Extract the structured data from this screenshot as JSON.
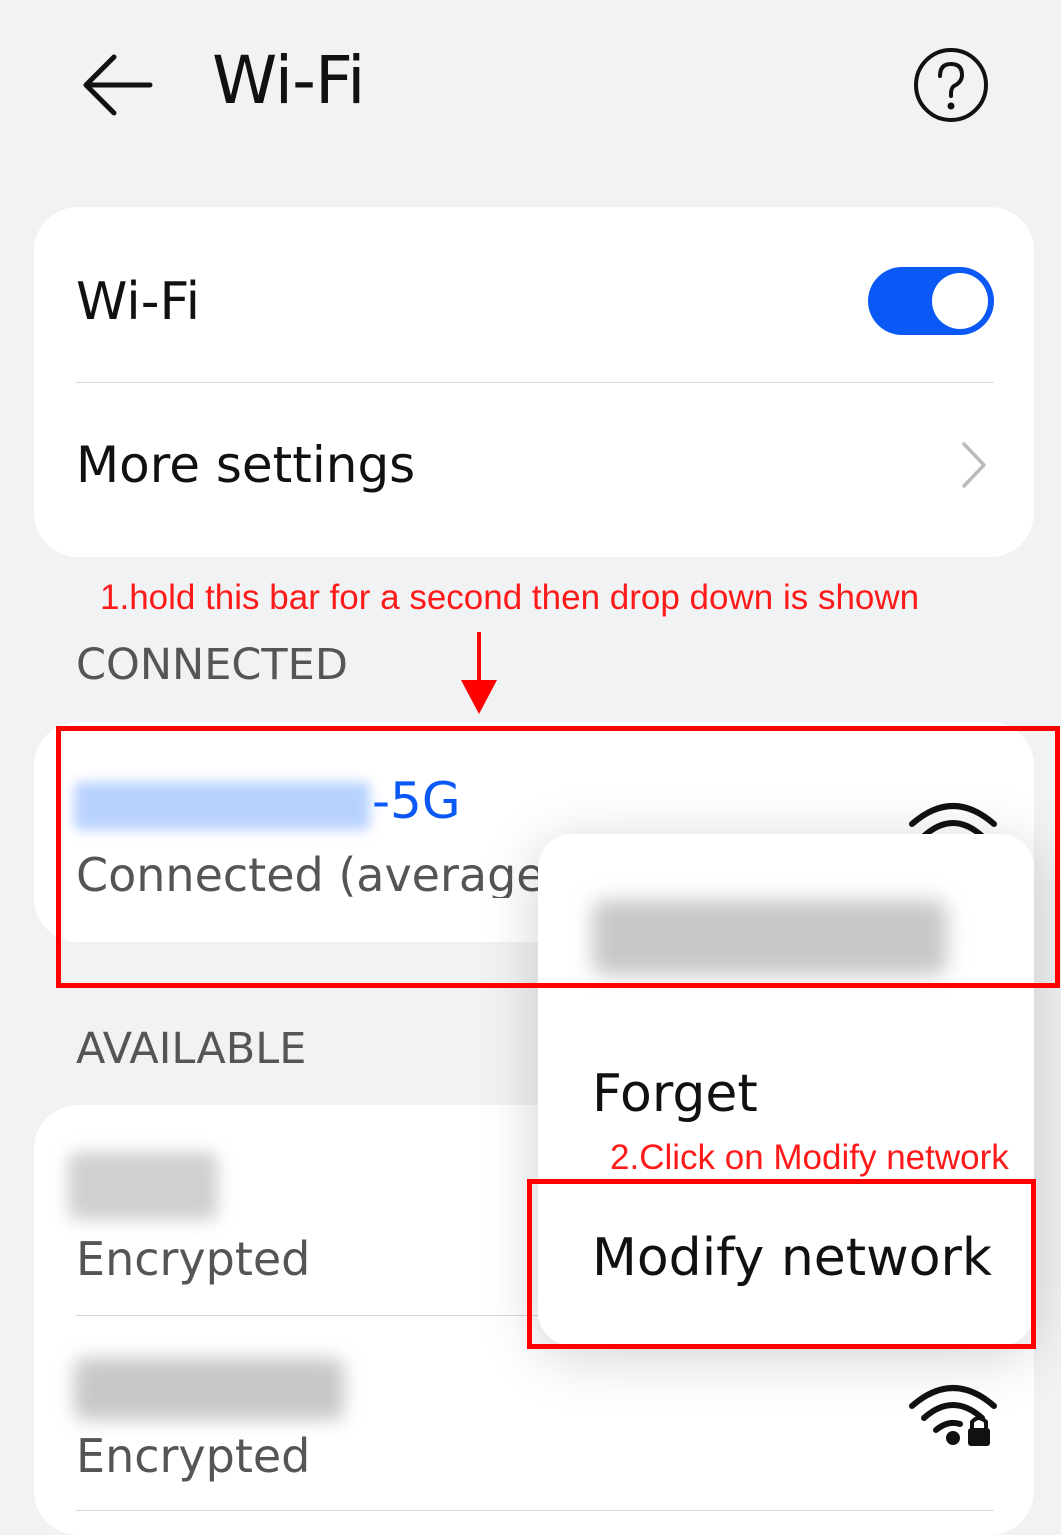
{
  "header": {
    "title": "Wi-Fi",
    "back_icon": "back-arrow-icon",
    "help_icon": "help-icon"
  },
  "settings": {
    "wifi_label": "Wi-Fi",
    "wifi_enabled": true,
    "more_settings_label": "More settings"
  },
  "annotations": {
    "step1": "1.hold this bar for a second then drop down is shown",
    "step2": "2.Click on Modify network"
  },
  "connected": {
    "section_label": "CONNECTED",
    "network_name_suffix": "-5G",
    "status": "Connected (average c"
  },
  "available": {
    "section_label": "AVAILABLE",
    "networks": [
      {
        "status": "Encrypted"
      },
      {
        "status": "Encrypted"
      }
    ]
  },
  "popup_menu": {
    "items": [
      "Forget",
      "Modify network"
    ]
  },
  "colors": {
    "accent": "#0a59f7",
    "annotation": "#ff0000",
    "background": "#f1f2f4"
  }
}
